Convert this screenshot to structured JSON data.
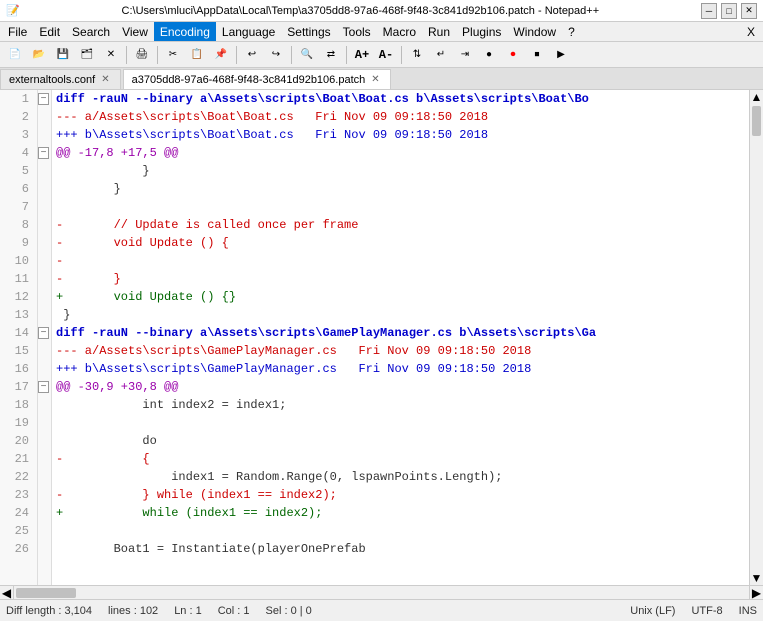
{
  "titleBar": {
    "text": "C:\\Users\\mluci\\AppData\\Local\\Temp\\a3705dd8-97a6-468f-9f48-3c841d92b106.patch - Notepad++",
    "minimize": "─",
    "maximize": "□",
    "close": "✕"
  },
  "menuBar": {
    "items": [
      "File",
      "Edit",
      "Search",
      "View",
      "Encoding",
      "Language",
      "Settings",
      "Tools",
      "Macro",
      "Run",
      "Plugins",
      "Window",
      "?",
      "X"
    ]
  },
  "tabs": [
    {
      "label": "externaltools.conf",
      "active": false
    },
    {
      "label": "a3705dd8-97a6-468f-9f48-3c841d92b106.patch",
      "active": true
    }
  ],
  "lines": [
    {
      "num": 1,
      "fold": "−",
      "hasFold": true,
      "text": "diff -rauN --binary a\\Assets\\scripts\\Boat\\Boat.cs b\\Assets\\scripts\\Boat\\Bo",
      "cls": "diff-header"
    },
    {
      "num": 2,
      "fold": "",
      "hasFold": false,
      "text": "--- a/Assets\\scripts\\Boat\\Boat.cs   Fri Nov 09 09:18:50 2018",
      "cls": "diff-old-file"
    },
    {
      "num": 3,
      "fold": "",
      "hasFold": false,
      "text": "+++ b\\Assets\\scripts\\Boat\\Boat.cs   Fri Nov 09 09:18:50 2018",
      "cls": "diff-new-file"
    },
    {
      "num": 4,
      "fold": "−",
      "hasFold": true,
      "text": "@@ -17,8 +17,5 @@",
      "cls": "diff-hunk"
    },
    {
      "num": 5,
      "fold": "",
      "hasFold": false,
      "text": "            }",
      "cls": "diff-context"
    },
    {
      "num": 6,
      "fold": "",
      "hasFold": false,
      "text": "        }",
      "cls": "diff-context"
    },
    {
      "num": 7,
      "fold": "",
      "hasFold": false,
      "text": "",
      "cls": "diff-context"
    },
    {
      "num": 8,
      "fold": "",
      "hasFold": false,
      "text": "-       // Update is called once per frame",
      "cls": "diff-removed"
    },
    {
      "num": 9,
      "fold": "",
      "hasFold": false,
      "text": "-       void Update () {",
      "cls": "diff-removed"
    },
    {
      "num": 10,
      "fold": "",
      "hasFold": false,
      "text": "-",
      "cls": "diff-removed"
    },
    {
      "num": 11,
      "fold": "",
      "hasFold": false,
      "text": "-       }",
      "cls": "diff-removed"
    },
    {
      "num": 12,
      "fold": "",
      "hasFold": false,
      "text": "+       void Update () {}",
      "cls": "diff-added"
    },
    {
      "num": 13,
      "fold": "",
      "hasFold": false,
      "text": " }",
      "cls": "diff-context"
    },
    {
      "num": 14,
      "fold": "−",
      "hasFold": true,
      "text": "diff -rauN --binary a\\Assets\\scripts\\GamePlayManager.cs b\\Assets\\scripts\\Ga",
      "cls": "diff-header"
    },
    {
      "num": 15,
      "fold": "",
      "hasFold": false,
      "text": "--- a/Assets\\scripts\\GamePlayManager.cs   Fri Nov 09 09:18:50 2018",
      "cls": "diff-old-file"
    },
    {
      "num": 16,
      "fold": "",
      "hasFold": false,
      "text": "+++ b\\Assets\\scripts\\GamePlayManager.cs   Fri Nov 09 09:18:50 2018",
      "cls": "diff-new-file"
    },
    {
      "num": 17,
      "fold": "−",
      "hasFold": true,
      "text": "@@ -30,9 +30,8 @@",
      "cls": "diff-hunk"
    },
    {
      "num": 18,
      "fold": "",
      "hasFold": false,
      "text": "            int index2 = index1;",
      "cls": "diff-context"
    },
    {
      "num": 19,
      "fold": "",
      "hasFold": false,
      "text": "",
      "cls": "diff-context"
    },
    {
      "num": 20,
      "fold": "",
      "hasFold": false,
      "text": "            do",
      "cls": "diff-context"
    },
    {
      "num": 21,
      "fold": "",
      "hasFold": false,
      "text": "-           {",
      "cls": "diff-removed"
    },
    {
      "num": 22,
      "fold": "",
      "hasFold": false,
      "text": "                index1 = Random.Range(0, lspawnPoints.Length);",
      "cls": "diff-context"
    },
    {
      "num": 23,
      "fold": "",
      "hasFold": false,
      "text": "-           } while (index1 == index2);",
      "cls": "diff-removed"
    },
    {
      "num": 24,
      "fold": "",
      "hasFold": false,
      "text": "+           while (index1 == index2);",
      "cls": "diff-added"
    },
    {
      "num": 25,
      "fold": "",
      "hasFold": false,
      "text": "",
      "cls": "diff-context"
    },
    {
      "num": 26,
      "fold": "",
      "hasFold": false,
      "text": "        Boat1 = Instantiate(playerOnePrefab",
      "cls": "diff-context"
    }
  ],
  "statusBar": {
    "diffLength": "Diff length : 3,104",
    "lines": "lines : 102",
    "ln": "Ln : 1",
    "col": "Col : 1",
    "sel": "Sel : 0 | 0",
    "unix": "Unix (LF)",
    "encoding": "UTF-8",
    "ins": "INS"
  }
}
